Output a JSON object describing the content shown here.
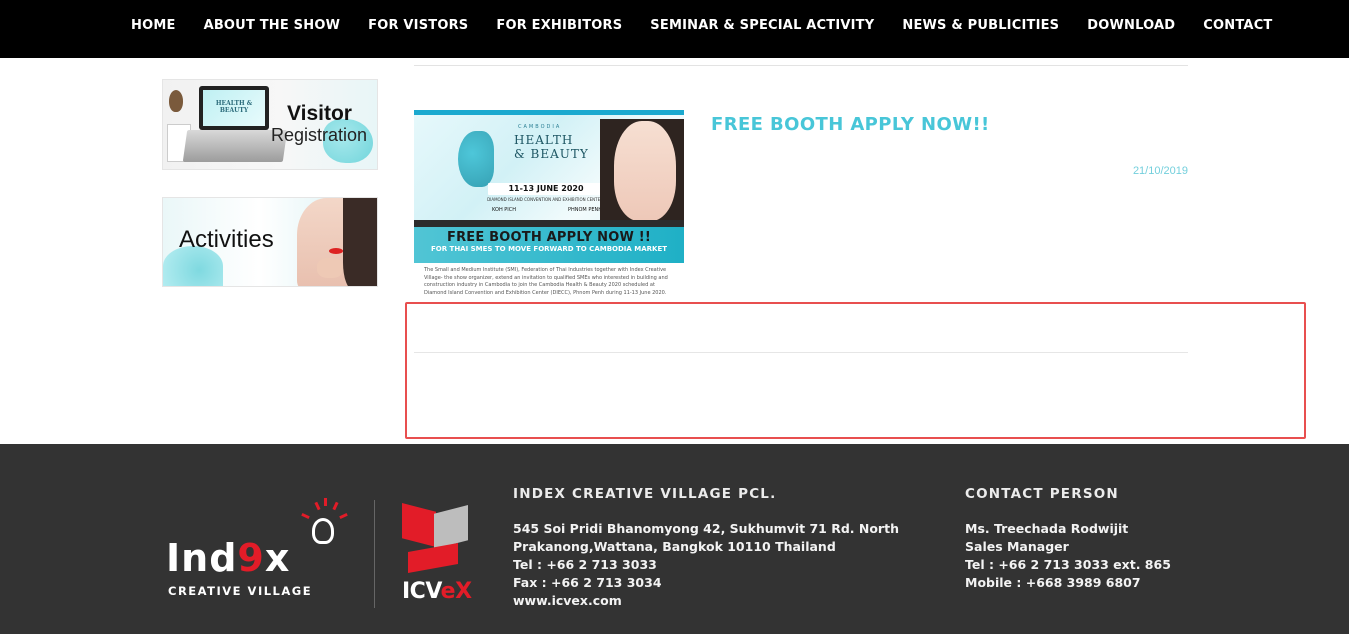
{
  "nav": {
    "items": [
      "HOME",
      "ABOUT THE SHOW",
      "FOR VISTORS",
      "FOR EXHIBITORS",
      "SEMINAR & SPECIAL ACTIVITY",
      "NEWS & PUBLICITIES",
      "DOWNLOAD",
      "CONTACT"
    ]
  },
  "sidebar": {
    "visitor_banner": {
      "line1": "Visitor",
      "line2": "Registration",
      "screen_text": "HEALTH & BEAUTY"
    },
    "activities_banner": {
      "title": "Activities"
    }
  },
  "article": {
    "title": "FREE BOOTH APPLY NOW!!",
    "date": "21/10/2019",
    "image": {
      "expo_small": "CAMBODIA",
      "expo_line1": "HEALTH",
      "expo_line2": "& BEAUTY",
      "expo_year": "EXPO 2020",
      "dates": "11-13 JUNE 2020",
      "venue": "DIAMOND ISLAND CONVENTION AND EXHIBITION CENTER",
      "city1": "KOH PICH",
      "city2": "PHNOM PENH",
      "cta_heading": "FREE BOOTH APPLY NOW !!",
      "cta_sub": "FOR THAI SMES TO MOVE FORWARD TO CAMBODIA MARKET",
      "body": "The Small and Medium Institute (SMI), Federation of Thai Industries together with Index Creative Village- the show organizer, extend an invitation to qualified SMEs who interested in building and construction industry in Cambodia to join the Cambodia Health & Beauty 2020 scheduled at Diamond Island Convention and Exhibition Center (DIECC), Phnom Penh during 11-13 June 2020."
    }
  },
  "footer": {
    "logo_index": {
      "word_a": "Ind",
      "word_b": "9",
      "word_c": "x",
      "sub": "CREATIVE VILLAGE"
    },
    "logo_icvex": {
      "word_a": "ICV",
      "word_b": "eX"
    },
    "company": {
      "heading": "INDEX CREATIVE VILLAGE PCL.",
      "lines": [
        "545 Soi Pridi Bhanomyong 42, Sukhumvit 71 Rd. North",
        "Prakanong,Wattana, Bangkok 10110 Thailand",
        "Tel : +66 2 713 3033",
        "Fax : +66 2 713 3034",
        "www.icvex.com"
      ]
    },
    "contact": {
      "heading": "CONTACT PERSON",
      "lines": [
        "Ms. Treechada Rodwijit",
        "Sales Manager",
        "Tel : +66 2 713 3033 ext. 865",
        "Mobile : +668 3989 6807"
      ]
    }
  },
  "colors": {
    "nav_bg": "#000000",
    "accent_teal": "#48c6d8",
    "footer_bg": "#333333",
    "brand_red": "#e21c28",
    "highlight_border": "#e84f4f"
  }
}
